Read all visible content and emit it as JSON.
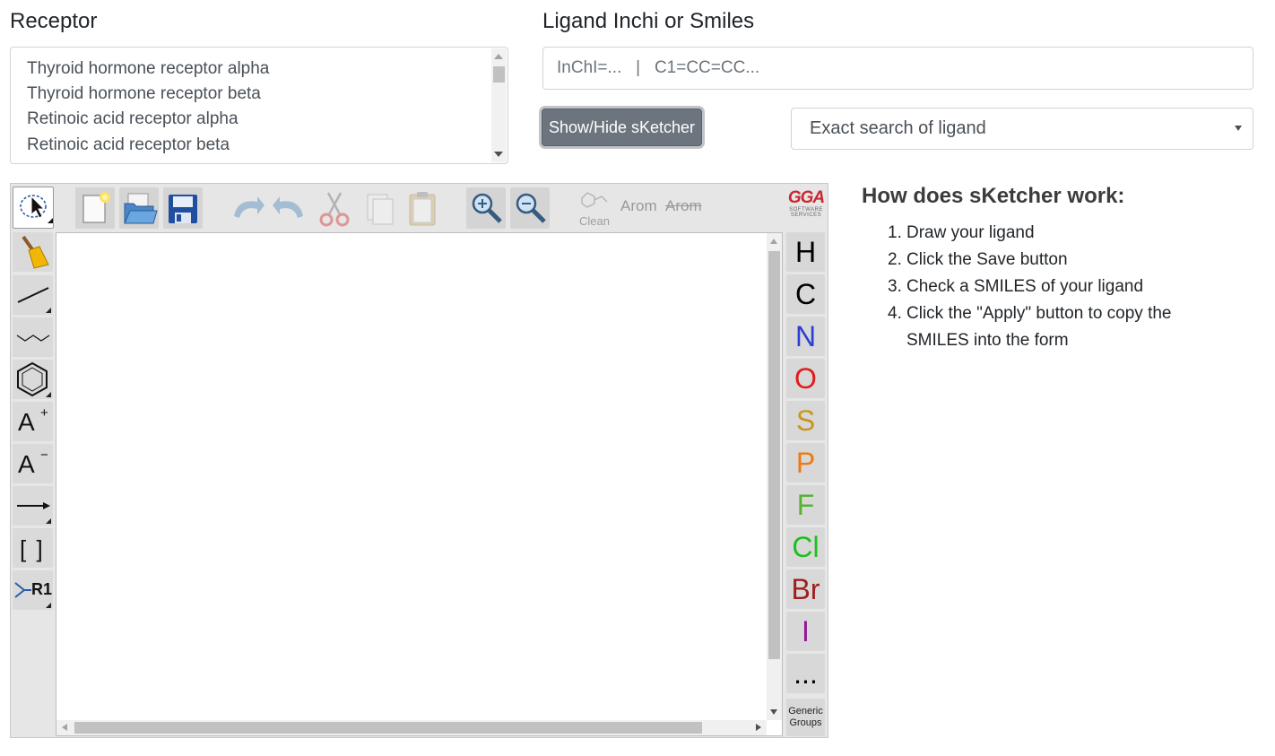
{
  "receptor": {
    "label": "Receptor",
    "options": [
      "Thyroid hormone receptor alpha",
      "Thyroid hormone receptor beta",
      "Retinoic acid receptor alpha",
      "Retinoic acid receptor beta"
    ]
  },
  "ligand": {
    "label": "Ligand Inchi or Smiles",
    "placeholder": "InChI=...   |   C1=CC=CC..."
  },
  "sketcher_toggle": {
    "label": "Show/Hide sKetcher"
  },
  "search_mode": {
    "selected": "Exact search of ligand"
  },
  "sketcher": {
    "top_toolbar": {
      "clean_label": "Clean",
      "arom_label": "Arom",
      "dearom_label": "Arom",
      "logo_text": "GGA",
      "logo_sub_1": "SOFTWARE",
      "logo_sub_2": "SERVICES"
    },
    "left_tools": {
      "charge_plus": "A",
      "charge_plus_sup": "+",
      "charge_minus": "A",
      "charge_minus_sup": "−",
      "bracket": "[ ]",
      "rgroup": "R1"
    },
    "atoms": [
      {
        "symbol": "H",
        "color": "#000000"
      },
      {
        "symbol": "C",
        "color": "#000000"
      },
      {
        "symbol": "N",
        "color": "#2b3fd6"
      },
      {
        "symbol": "O",
        "color": "#e01b1b"
      },
      {
        "symbol": "S",
        "color": "#c8961f"
      },
      {
        "symbol": "P",
        "color": "#ee7a11"
      },
      {
        "symbol": "F",
        "color": "#57b233"
      },
      {
        "symbol": "Cl",
        "color": "#19c219"
      },
      {
        "symbol": "Br",
        "color": "#a01e1e"
      },
      {
        "symbol": "I",
        "color": "#94169c"
      },
      {
        "symbol": "...",
        "color": "#000000"
      }
    ],
    "generic_groups_1": "Generic",
    "generic_groups_2": "Groups"
  },
  "howto": {
    "title": "How does sKetcher work:",
    "steps": [
      {
        "num": "1.",
        "text": "Draw your ligand"
      },
      {
        "num": "2.",
        "text": "Click the Save button"
      },
      {
        "num": "3.",
        "text": "Check a SMILES of your ligand"
      },
      {
        "num": "4.",
        "text": "Click the \"Apply\" button to copy the SMILES into the form"
      }
    ]
  }
}
